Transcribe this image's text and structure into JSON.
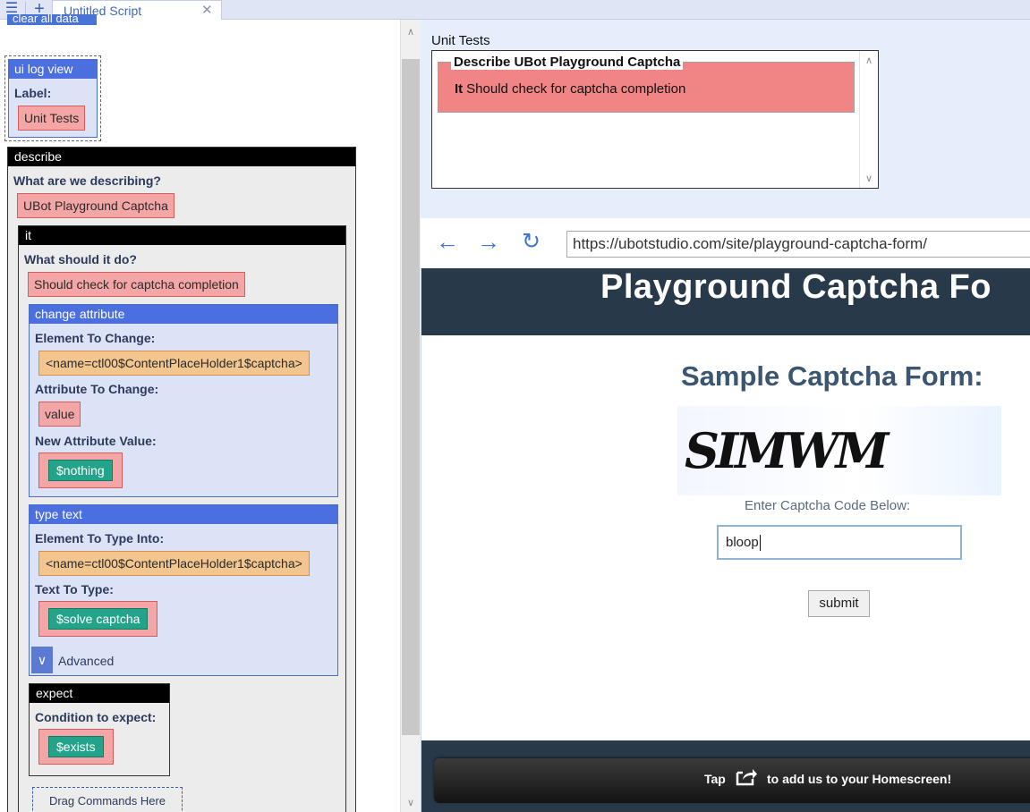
{
  "tab": {
    "menu_icon": "hamburger-icon",
    "new_icon": "plus-icon",
    "title": "Untitled Script",
    "close_icon": "close-icon"
  },
  "left": {
    "clear_label": "clear all data",
    "ui_log_view": {
      "header": "ui log view",
      "label_caption": "Label:",
      "label_value": "Unit Tests"
    },
    "describe": {
      "header": "describe",
      "caption": "What are we describing?",
      "value": "UBot Playground Captcha",
      "it": {
        "header": "it",
        "caption": "What should it do?",
        "value": "Should check for captcha completion",
        "change_attribute": {
          "header": "change attribute",
          "element_caption": "Element To Change:",
          "element_value": "<name=ctl00$ContentPlaceHolder1$captcha>",
          "attribute_caption": "Attribute To Change:",
          "attribute_value": "value",
          "new_value_caption": "New Attribute Value:",
          "new_value": "$nothing"
        },
        "type_text": {
          "header": "type text",
          "element_caption": "Element To Type Into:",
          "element_value": "<name=ctl00$ContentPlaceHolder1$captcha>",
          "text_caption": "Text To Type:",
          "text_value": "$solve captcha",
          "advanced_label": "Advanced",
          "advanced_icon": "chevron-down-icon"
        },
        "expect": {
          "header": "expect",
          "caption": "Condition to expect:",
          "value": "$exists"
        },
        "drag_zone": "Drag Commands Here"
      }
    }
  },
  "right": {
    "unit_tests": {
      "title": "Unit Tests",
      "legend": "Describe UBot Playground Captcha",
      "it_label": "It",
      "it_text": "Should check for captcha completion"
    },
    "browser": {
      "back_icon": "arrow-left-icon",
      "forward_icon": "arrow-right-icon",
      "reload_icon": "reload-icon",
      "url": "https://ubotstudio.com/site/playground-captcha-form/"
    },
    "webpage": {
      "heading": "Playground Captcha Fo",
      "subheading": "Sample Captcha Form:",
      "captcha_text": "SIMWM",
      "captcha_caption": "Enter Captcha Code Below:",
      "input_value": "bloop",
      "submit_label": "submit",
      "homescreen_tap": "Tap",
      "homescreen_rest": "to add us to your Homescreen!",
      "homescreen_icon": "share-icon"
    }
  }
}
